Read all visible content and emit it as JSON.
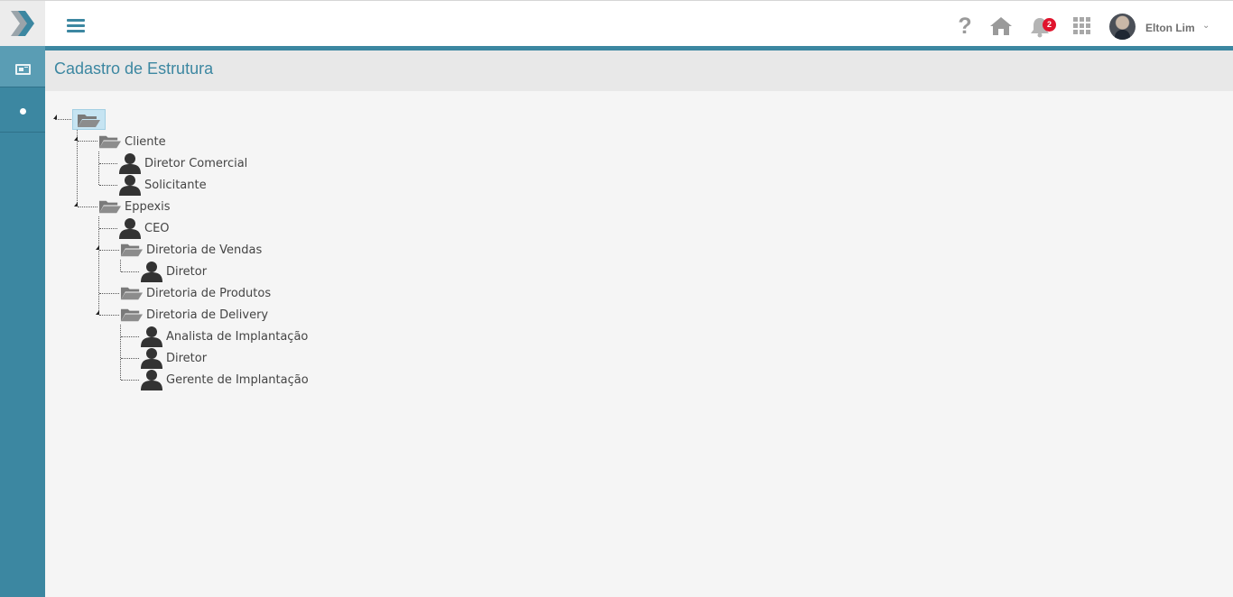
{
  "header": {
    "user_name": "Elton Lim",
    "notifications_count": "2",
    "icons": [
      "logo-icon",
      "hamburger-icon",
      "help-icon",
      "home-icon",
      "bell-icon",
      "apps-grid-icon",
      "avatar",
      "chevron-down-icon"
    ]
  },
  "sidebar": {
    "items": [
      {
        "icon": "id-card-icon",
        "active": true
      },
      {
        "icon": "dot-icon",
        "active": false
      }
    ]
  },
  "page": {
    "title": "Cadastro de Estrutura"
  },
  "tree": {
    "root_label": "",
    "groups": [
      {
        "label": "Cliente",
        "children": [
          {
            "type": "person",
            "label": "Diretor Comercial"
          },
          {
            "type": "person",
            "label": "Solicitante"
          }
        ]
      },
      {
        "label": "Eppexis",
        "children": [
          {
            "type": "person",
            "label": "CEO"
          },
          {
            "type": "folder",
            "label": "Diretoria de Vendas",
            "children": [
              {
                "type": "person",
                "label": "Diretor"
              }
            ]
          },
          {
            "type": "folder",
            "label": "Diretoria de Produtos",
            "children": []
          },
          {
            "type": "folder",
            "label": "Diretoria de Delivery",
            "children": [
              {
                "type": "person",
                "label": "Analista de Implantação"
              },
              {
                "type": "person",
                "label": "Diretor"
              },
              {
                "type": "person",
                "label": "Gerente de Implantação"
              }
            ]
          }
        ]
      }
    ]
  },
  "colors": {
    "accent": "#3c87a1",
    "badge": "#e0142d",
    "icon_gray": "#9a9a9a"
  }
}
